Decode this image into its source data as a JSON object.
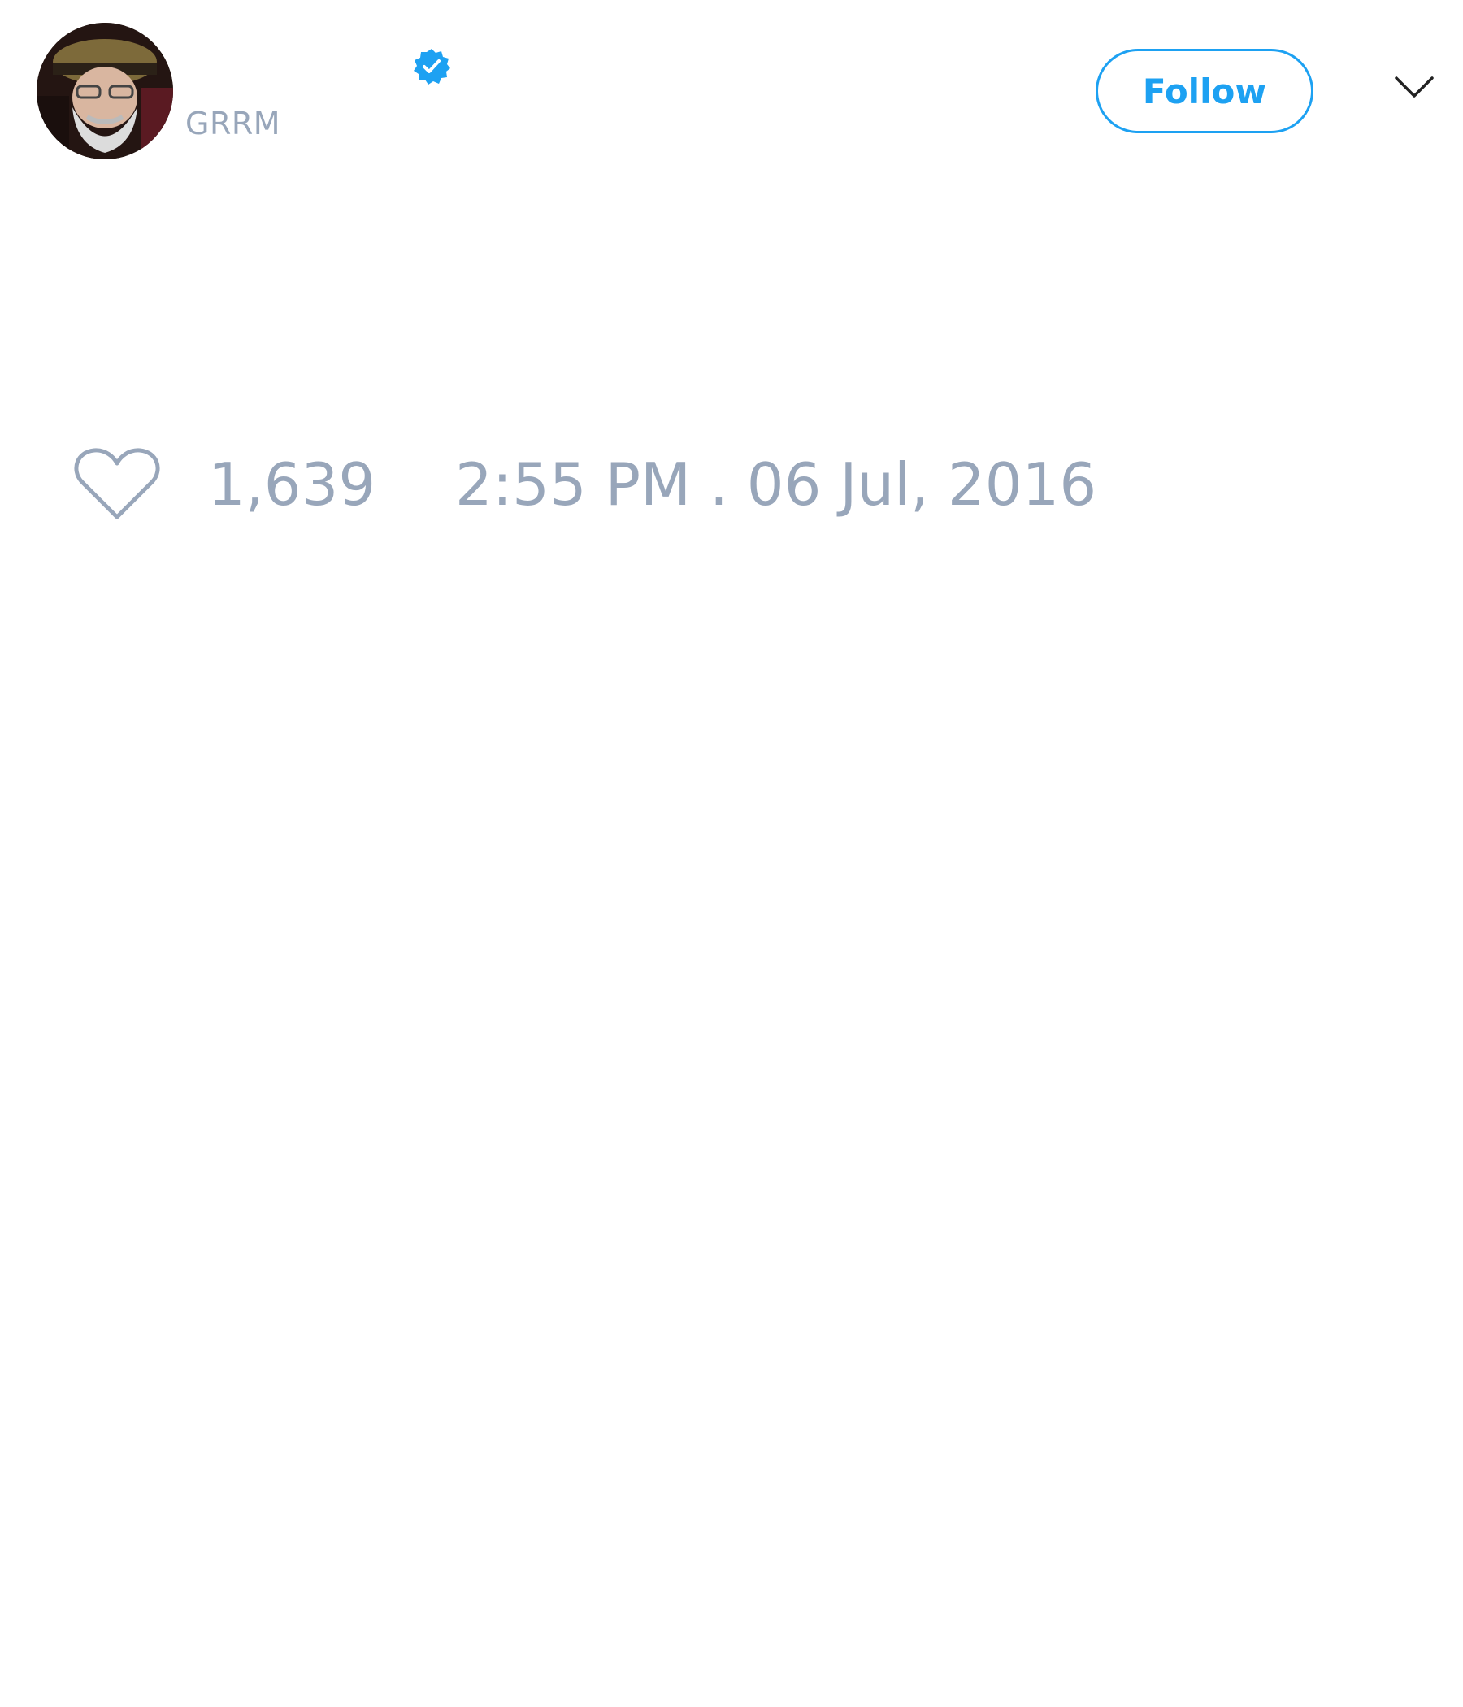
{
  "tweet": {
    "author": {
      "handle": "GRRM",
      "verified": true,
      "avatar": "author-photo"
    },
    "follow_label": "Follow",
    "menu_icon": "chevron-down-icon",
    "likes": "1,639",
    "timestamp": "2:55 PM . 06 Jul, 2016"
  },
  "colors": {
    "accent": "#1da1f2",
    "muted_text": "#98a6ba"
  }
}
